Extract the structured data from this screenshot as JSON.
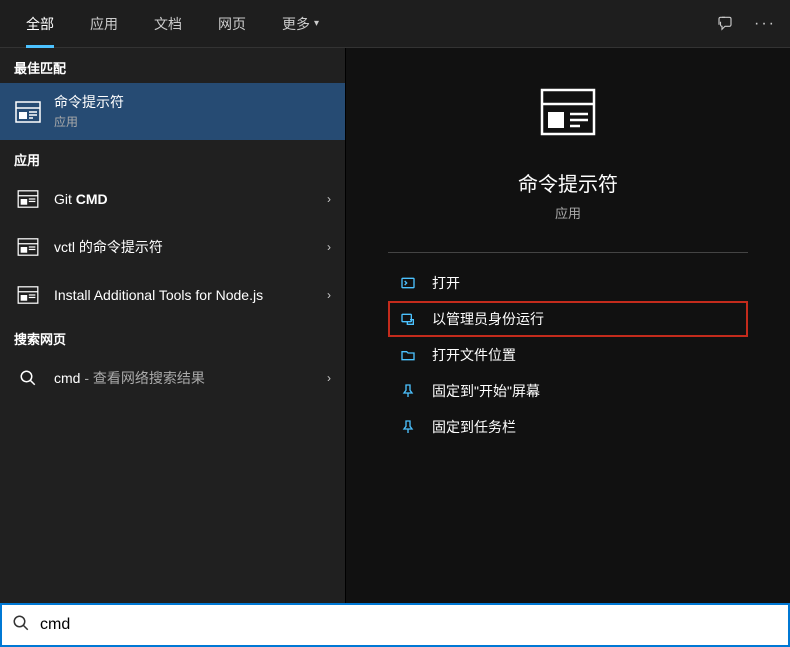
{
  "tabs": {
    "all": "全部",
    "apps": "应用",
    "docs": "文档",
    "web": "网页",
    "more": "更多"
  },
  "sections": {
    "best": "最佳匹配",
    "apps": "应用",
    "web": "搜索网页"
  },
  "best_match": {
    "title": "命令提示符",
    "sub": "应用"
  },
  "app_results": [
    {
      "prefix": "Git ",
      "bold": "CMD"
    },
    {
      "text": "vctl 的命令提示符"
    },
    {
      "text": "Install Additional Tools for Node.js"
    }
  ],
  "web_result": {
    "term": "cmd",
    "suffix": " - 查看网络搜索结果"
  },
  "preview": {
    "title": "命令提示符",
    "sub": "应用"
  },
  "actions": {
    "open": "打开",
    "run_admin": "以管理员身份运行",
    "open_location": "打开文件位置",
    "pin_start": "固定到\"开始\"屏幕",
    "pin_taskbar": "固定到任务栏"
  },
  "search": {
    "value": "cmd"
  }
}
